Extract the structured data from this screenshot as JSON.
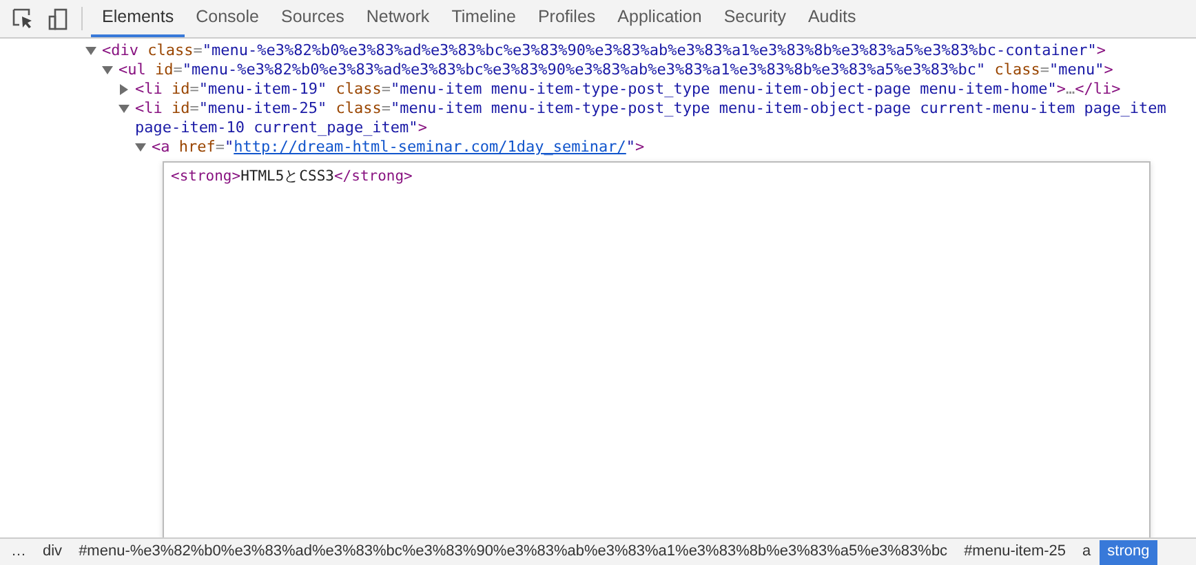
{
  "toolbar": {
    "tabs": [
      {
        "label": "Elements",
        "selected": true
      },
      {
        "label": "Console",
        "selected": false
      },
      {
        "label": "Sources",
        "selected": false
      },
      {
        "label": "Network",
        "selected": false
      },
      {
        "label": "Timeline",
        "selected": false
      },
      {
        "label": "Profiles",
        "selected": false
      },
      {
        "label": "Application",
        "selected": false
      },
      {
        "label": "Security",
        "selected": false
      },
      {
        "label": "Audits",
        "selected": false
      }
    ]
  },
  "dom_tree": [
    {
      "expanded": true,
      "tokens": [
        {
          "kind": "tag",
          "text": "<div"
        },
        {
          "kind": "attr",
          "text": " class"
        },
        {
          "kind": "punct",
          "text": "="
        },
        {
          "kind": "value",
          "text": "\"menu-%e3%82%b0%e3%83%ad%e3%83%bc%e3%83%90%e3%83%ab%e3%83%a1%e3%83%8b%e3%83%a5%e3%83%bc-container\""
        },
        {
          "kind": "tag",
          "text": ">"
        }
      ],
      "children": [
        {
          "expanded": true,
          "tokens": [
            {
              "kind": "tag",
              "text": "<ul"
            },
            {
              "kind": "attr",
              "text": " id"
            },
            {
              "kind": "punct",
              "text": "="
            },
            {
              "kind": "value",
              "text": "\"menu-%e3%82%b0%e3%83%ad%e3%83%bc%e3%83%90%e3%83%ab%e3%83%a1%e3%83%8b%e3%83%a5%e3%83%bc\""
            },
            {
              "kind": "attr",
              "text": " class"
            },
            {
              "kind": "punct",
              "text": "="
            },
            {
              "kind": "value",
              "text": "\"menu\""
            },
            {
              "kind": "tag",
              "text": ">"
            }
          ],
          "children": [
            {
              "expanded": false,
              "tokens": [
                {
                  "kind": "tag",
                  "text": "<li"
                },
                {
                  "kind": "attr",
                  "text": " id"
                },
                {
                  "kind": "punct",
                  "text": "="
                },
                {
                  "kind": "value",
                  "text": "\"menu-item-19\""
                },
                {
                  "kind": "attr",
                  "text": " class"
                },
                {
                  "kind": "punct",
                  "text": "="
                },
                {
                  "kind": "value",
                  "text": "\"menu-item menu-item-type-post_type menu-item-object-page menu-item-home\""
                },
                {
                  "kind": "tag",
                  "text": ">"
                },
                {
                  "kind": "punct",
                  "text": "…"
                },
                {
                  "kind": "tag",
                  "text": "</li>"
                }
              ]
            },
            {
              "expanded": true,
              "tokens": [
                {
                  "kind": "tag",
                  "text": "<li"
                },
                {
                  "kind": "attr",
                  "text": " id"
                },
                {
                  "kind": "punct",
                  "text": "="
                },
                {
                  "kind": "value",
                  "text": "\"menu-item-25\""
                },
                {
                  "kind": "attr",
                  "text": " class"
                },
                {
                  "kind": "punct",
                  "text": "="
                },
                {
                  "kind": "value",
                  "text": "\"menu-item menu-item-type-post_type menu-item-object-page current-menu-item page_item page-item-10 current_page_item\""
                },
                {
                  "kind": "tag",
                  "text": ">"
                }
              ],
              "children": [
                {
                  "expanded": true,
                  "tokens": [
                    {
                      "kind": "tag",
                      "text": "<a"
                    },
                    {
                      "kind": "attr",
                      "text": " href"
                    },
                    {
                      "kind": "punct",
                      "text": "="
                    },
                    {
                      "kind": "value",
                      "text": "\""
                    },
                    {
                      "kind": "link",
                      "text": "http://dream-html-seminar.com/1day_seminar/"
                    },
                    {
                      "kind": "value",
                      "text": "\""
                    },
                    {
                      "kind": "tag",
                      "text": ">"
                    }
                  ],
                  "children": [
                    {
                      "kind": "editor",
                      "tokens": [
                        {
                          "kind": "tag",
                          "text": "<strong>"
                        },
                        {
                          "kind": "text",
                          "text": "HTML5とCSS3"
                        },
                        {
                          "kind": "tag",
                          "text": "</strong>"
                        }
                      ]
                    }
                  ]
                }
              ]
            }
          ]
        }
      ]
    }
  ],
  "breadcrumbs": [
    {
      "label": "…",
      "selected": false
    },
    {
      "label": "div",
      "selected": false
    },
    {
      "label": "#menu-%e3%82%b0%e3%83%ad%e3%83%bc%e3%83%90%e3%83%ab%e3%83%a1%e3%83%8b%e3%83%a5%e3%83%bc",
      "selected": false
    },
    {
      "label": "#menu-item-25",
      "selected": false
    },
    {
      "label": "a",
      "selected": false
    },
    {
      "label": "strong",
      "selected": true
    }
  ]
}
